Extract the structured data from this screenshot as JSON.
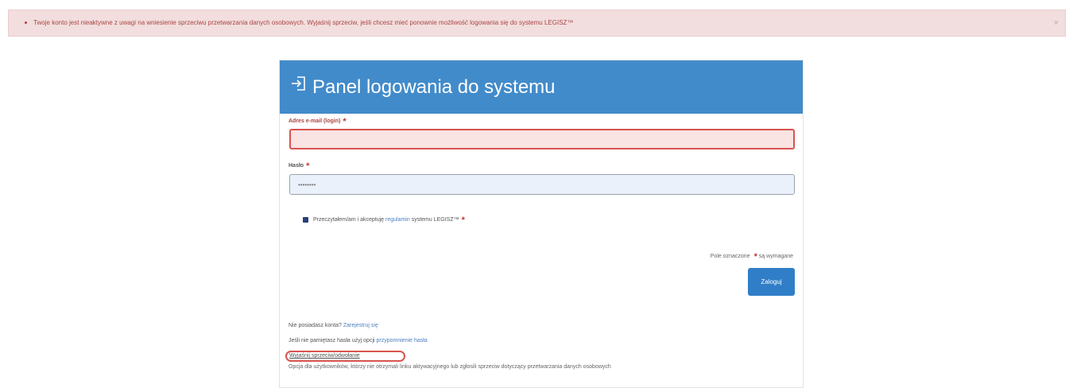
{
  "alert": {
    "message": "Twoje konto jest nieaktywne z uwagi na wniesienie sprzeciwu przetwarzania danych osobowych. Wyjaśnij sprzeciw, jeśli chcesz mieć ponownie możliwość logowania się do systemu LEGISZ™",
    "close_label": "×"
  },
  "panel": {
    "title": "Panel logowania do systemu"
  },
  "form": {
    "email_label": "Adres e-mail (login)",
    "email_value": "",
    "password_label": "Hasło",
    "password_value": "••••••••",
    "required_mark": "*",
    "consent_prefix": "Przeczytałem/am i akceptuję",
    "consent_link": "regulamin",
    "consent_suffix": "systemu LEGISZ™",
    "req_note_prefix": "Pole oznaczone",
    "req_note_suffix": "są wymagane",
    "submit_label": "Zaloguj"
  },
  "links": {
    "no_account_prefix": "Nie posiadasz konta?",
    "no_account_link": "Zarejestruj się",
    "forgot_prefix": "Jeśli nie pamiętasz hasła użyj opcji",
    "forgot_link": "przypomnienie hasła",
    "withdraw_link": "Wyjaśnij sprzeciw/odwołanie",
    "withdraw_desc": "Opcja dla użytkowników, którzy nie otrzymali linku aktywacyjnego lub zgłosili sprzeciw dotyczący przetwarzania danych osobowych"
  },
  "colors": {
    "header_blue": "#428bca",
    "error_red": "#d9534f",
    "alert_bg": "#f2dede",
    "button_blue": "#2f7ec7"
  }
}
